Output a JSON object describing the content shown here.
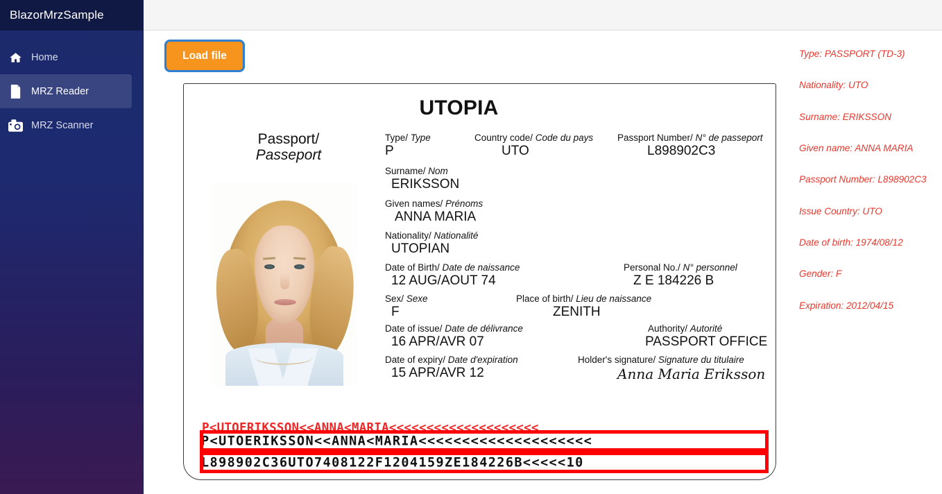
{
  "app": {
    "brand": "BlazorMrzSample"
  },
  "sidebar": {
    "items": [
      {
        "label": "Home",
        "icon": "home-icon",
        "active": false
      },
      {
        "label": "MRZ Reader",
        "icon": "document-icon",
        "active": true
      },
      {
        "label": "MRZ Scanner",
        "icon": "camera-icon",
        "active": false
      }
    ]
  },
  "toolbar": {
    "load_file_label": "Load file"
  },
  "passport": {
    "country_title": "UTOPIA",
    "doc_label_line1": "Passport/",
    "doc_label_line2": "Passeport",
    "fields": {
      "type_label": "Type/ ",
      "type_label_it": "Type",
      "type_value": "P",
      "country_code_label": "Country code/ ",
      "country_code_label_it": "Code du pays",
      "country_code_value": "UTO",
      "passport_number_label": "Passport Number/ ",
      "passport_number_label_it": "N° de passeport",
      "passport_number_value": "L898902C3",
      "surname_label": "Surname/ ",
      "surname_label_it": "Nom",
      "surname_value": "ERIKSSON",
      "given_names_label": "Given names/ ",
      "given_names_label_it": "Prénoms",
      "given_names_value": "ANNA MARIA",
      "nationality_label": "Nationality/ ",
      "nationality_label_it": "Nationalité",
      "nationality_value": "UTOPIAN",
      "dob_label": "Date of Birth/ ",
      "dob_label_it": "Date de naissance",
      "dob_value": "12 AUG/AOUT 74",
      "personal_no_label": "Personal No./ ",
      "personal_no_label_it": "N° personnel",
      "personal_no_value": "Z E 184226 B",
      "sex_label": "Sex/ ",
      "sex_label_it": "Sexe",
      "sex_value": "F",
      "pob_label": "Place of birth/ ",
      "pob_label_it": "Lieu de naissance",
      "pob_value": "ZENITH",
      "issue_label": "Date of issue/ ",
      "issue_label_it": "Date de délivrance",
      "issue_value": "16 APR/AVR 07",
      "authority_label": "Authority/ ",
      "authority_label_it": "Autorité",
      "authority_value": "PASSPORT OFFICE",
      "expiry_label": "Date of expiry/ ",
      "expiry_label_it": "Date d'expiration",
      "expiry_value": "15 APR/AVR 12",
      "signature_label": "Holder's signature/ ",
      "signature_label_it": "Signature du titulaire",
      "signature_value": "Anna Maria Eriksson"
    },
    "mrz": {
      "line1": "P<UTOERIKSSON<<ANNA<MARIA<<<<<<<<<<<<<<<<<<<<",
      "line2": "L898902C36UTO7408122F1204159ZE184226B<<<<<10",
      "detected_line1": "P<UTOERIKSSON<<ANNA<MARIA<<<<<<<<<<<<<<<<<<<<",
      "detected_line2": "L898902C36UTO7408122F1204159ZE184226B<<<<<10",
      "highlight_color": "#ff0000",
      "raw_color": "#ef2828"
    }
  },
  "results": {
    "accent_color": "#e8372c",
    "lines": [
      "Type: PASSPORT (TD-3)",
      "Nationality: UTO",
      "Surname: ERIKSSON",
      "Given name: ANNA MARIA",
      "Passport Number: L898902C3",
      "Issue Country: UTO",
      "Date of birth: 1974/08/12",
      "Gender: F",
      "Expiration: 2012/04/15"
    ]
  }
}
